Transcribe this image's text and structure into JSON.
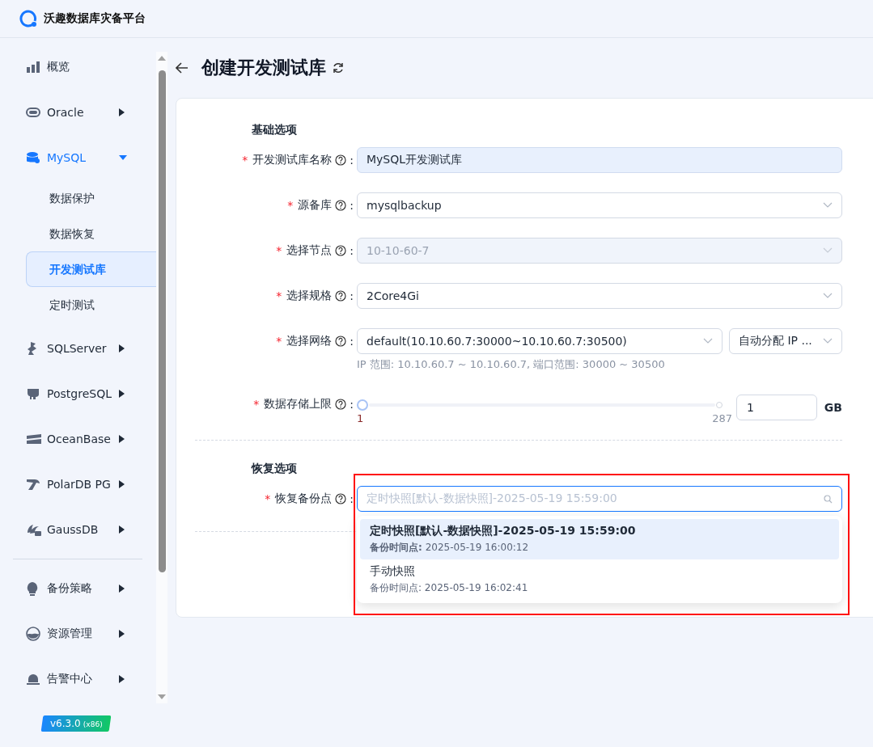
{
  "app": {
    "title": "沃趣数据库灾备平台"
  },
  "sidebar": {
    "groups": [
      {
        "items": [
          {
            "label": "概览"
          },
          {
            "label": "Oracle",
            "expanded": false,
            "active": false
          },
          {
            "label": "MySQL",
            "expanded": true,
            "active": true,
            "children": [
              {
                "label": "数据保护",
                "selected": false
              },
              {
                "label": "数据恢复",
                "selected": false
              },
              {
                "label": "开发测试库",
                "selected": true
              },
              {
                "label": "定时测试",
                "selected": false
              }
            ]
          },
          {
            "label": "SQLServer",
            "expanded": false,
            "active": false
          },
          {
            "label": "PostgreSQL",
            "expanded": false,
            "active": false
          },
          {
            "label": "OceanBase",
            "expanded": false,
            "active": false
          },
          {
            "label": "PolarDB PG",
            "expanded": false,
            "active": false
          },
          {
            "label": "GaussDB",
            "expanded": false,
            "active": false
          }
        ]
      },
      {
        "items": [
          {
            "label": "备份策略",
            "expanded": false,
            "active": false
          },
          {
            "label": "资源管理",
            "expanded": false,
            "active": false
          },
          {
            "label": "告警中心",
            "expanded": false,
            "active": false
          }
        ]
      }
    ],
    "version": "v6.3.0",
    "arch": "(x86)"
  },
  "page": {
    "title": "创建开发测试库",
    "sections": [
      {
        "title": "基础选项",
        "fields": [
          {
            "kind": "input",
            "required_mark": "*",
            "label": "开发测试库名称",
            "colon": ":",
            "value": "MySQL开发测试库"
          },
          {
            "kind": "select",
            "required_mark": "*",
            "label": "源备库",
            "colon": ":",
            "value": "mysqlbackup",
            "disabled": false
          },
          {
            "kind": "select",
            "required_mark": "*",
            "label": "选择节点",
            "colon": ":",
            "value": "10-10-60-7",
            "disabled": true
          },
          {
            "kind": "select",
            "required_mark": "*",
            "label": "选择规格",
            "colon": ":",
            "value": "2Core4Gi",
            "disabled": false
          },
          {
            "kind": "select-pair",
            "required_mark": "*",
            "label": "选择网络",
            "colon": ":",
            "values": [
              "default(10.10.60.7:30000~10.10.60.7:30500)",
              "自动分配 IP ..."
            ],
            "hint": "IP 范围: 10.10.60.7 ~ 10.10.60.7, 端口范围: 30000 ~ 30500"
          },
          {
            "kind": "slider",
            "required_mark": "*",
            "label": "数据存储上限",
            "colon": ":",
            "level": 0,
            "min": "1",
            "max": "287",
            "value": "1",
            "unit": "GB"
          }
        ]
      },
      {
        "title": "恢复选项",
        "fields": [
          {
            "kind": "search-select",
            "required_mark": "*",
            "label": "恢复备份点",
            "colon": ":",
            "placeholder": "定时快照[默认-数据快照]-2025-05-19 15:59:00",
            "open": true,
            "highlighted": true,
            "options": [
              {
                "title": "定时快照[默认-数据快照]-2025-05-19 15:59:00",
                "detail": "**备份时间点:** 2025-05-19 16:00:12",
                "selected": true
              },
              {
                "title": "手动快照",
                "detail": "备份时间点: 2025-05-19 16:02:41",
                "selected": false
              }
            ]
          }
        ]
      }
    ]
  }
}
